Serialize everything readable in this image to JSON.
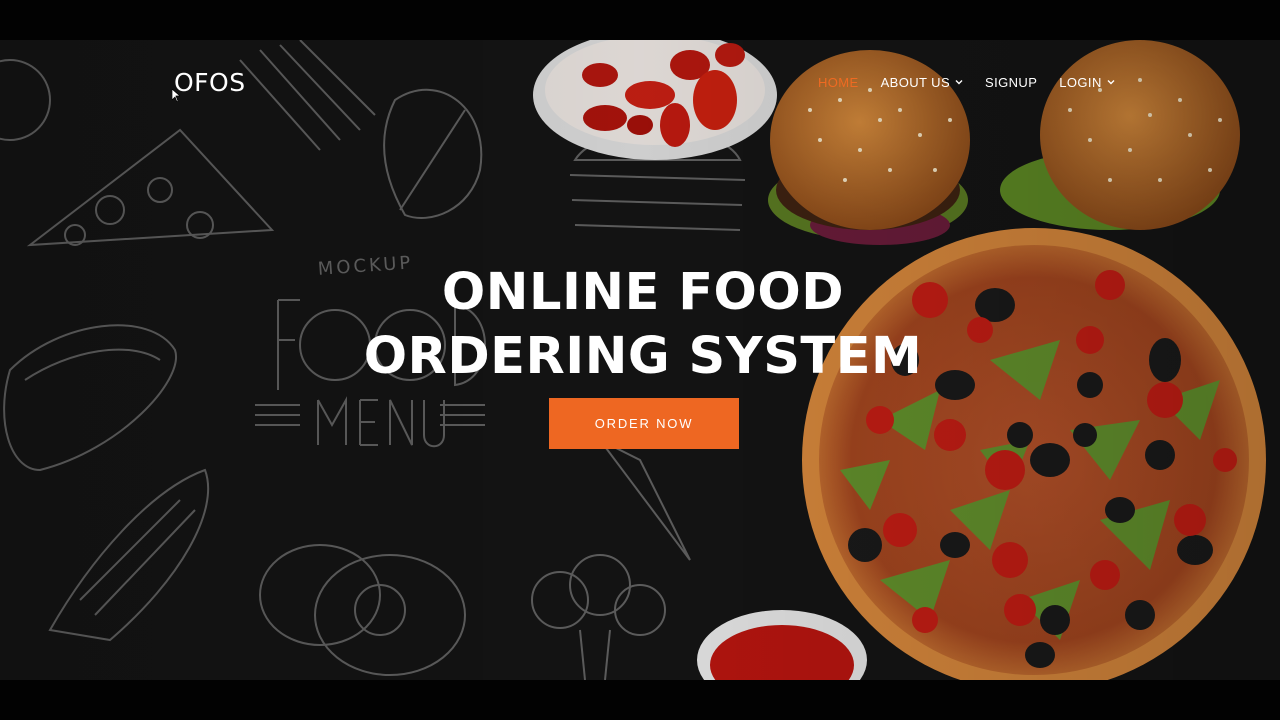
{
  "brand": {
    "logo": "OFOS"
  },
  "nav": {
    "items": [
      {
        "label": "HOME",
        "active": true,
        "dropdown": false
      },
      {
        "label": "ABOUT US",
        "active": false,
        "dropdown": true
      },
      {
        "label": "SIGNUP",
        "active": false,
        "dropdown": false
      },
      {
        "label": "LOGIN",
        "active": false,
        "dropdown": true
      }
    ]
  },
  "hero": {
    "title_line1": "ONLINE FOOD",
    "title_line2": "ORDERING SYSTEM",
    "cta_label": "ORDER NOW",
    "chalkboard_text_top": "MOCKUP",
    "chalkboard_text_main": "FOOD",
    "chalkboard_text_bottom": "MENU"
  },
  "colors": {
    "accent": "#ee6722",
    "background": "#141414",
    "text": "#ffffff"
  }
}
